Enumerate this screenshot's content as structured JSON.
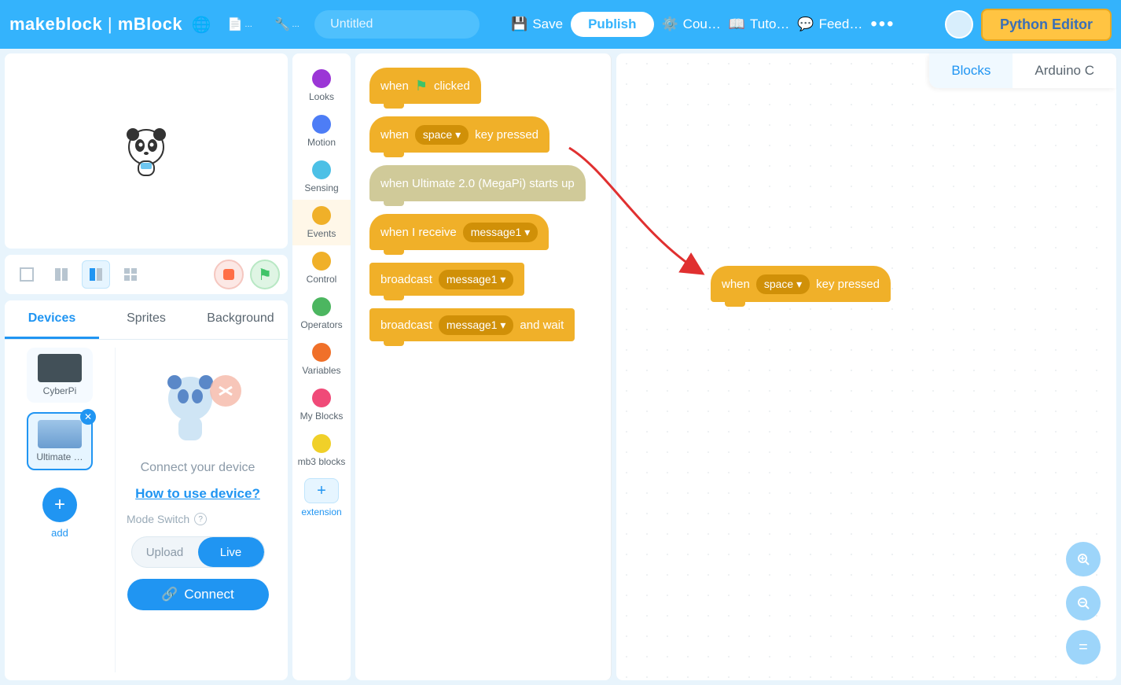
{
  "topbar": {
    "brand1": "makeblock",
    "brand2": "mBlock",
    "project_name": "Untitled",
    "save": "Save",
    "publish": "Publish",
    "courses": "Cou…",
    "tutorials": "Tuto…",
    "feedback": "Feed…",
    "python_editor": "Python Editor"
  },
  "stage_controls": {},
  "tabs": {
    "devices": "Devices",
    "sprites": "Sprites",
    "background": "Background"
  },
  "devices": {
    "cyberpi": "CyberPi",
    "ultimate": "Ultimate …",
    "add": "add",
    "connect_prompt": "Connect your device",
    "howto": "How to use device?",
    "mode_switch_label": "Mode Switch",
    "upload": "Upload",
    "live": "Live",
    "connect": "Connect"
  },
  "categories": [
    {
      "name": "Looks",
      "color": "#9b36d6"
    },
    {
      "name": "Motion",
      "color": "#4d7df6"
    },
    {
      "name": "Sensing",
      "color": "#4cc0e6"
    },
    {
      "name": "Events",
      "color": "#f0b029"
    },
    {
      "name": "Control",
      "color": "#f0b029"
    },
    {
      "name": "Operators",
      "color": "#4cb660"
    },
    {
      "name": "Variables",
      "color": "#f07029"
    },
    {
      "name": "My Blocks",
      "color": "#f04a78"
    },
    {
      "name": "mb3 blocks",
      "color": "#f0d029"
    }
  ],
  "extension": "extension",
  "palette": {
    "when_flag": {
      "pre": "when",
      "post": "clicked"
    },
    "when_key": {
      "pre": "when",
      "arg": "space ▾",
      "post": "key pressed"
    },
    "when_starts": "when Ultimate 2.0  (MegaPi)  starts up",
    "when_receive": {
      "pre": "when I receive",
      "arg": "message1 ▾"
    },
    "broadcast": {
      "pre": "broadcast",
      "arg": "message1 ▾"
    },
    "broadcast_wait": {
      "pre": "broadcast",
      "arg": "message1 ▾",
      "post": "and wait"
    }
  },
  "canvas_block": {
    "pre": "when",
    "arg": "space ▾",
    "post": "key pressed"
  },
  "code_tabs": {
    "blocks": "Blocks",
    "arduino": "Arduino C"
  }
}
